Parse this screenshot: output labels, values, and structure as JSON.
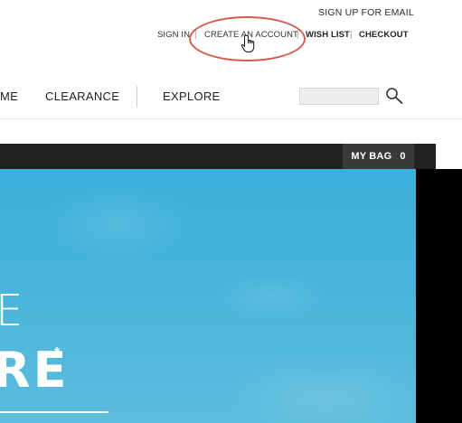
{
  "utility": {
    "email_signup": "SIGN UP FOR EMAIL",
    "sign_in": "SIGN IN",
    "separator": "|",
    "create_account": "CREATE AN ACCOUNT",
    "wish_list": "WISH LIST",
    "checkout": "CHECKOUT"
  },
  "nav": {
    "item_partial": "ME",
    "clearance": "CLEARANCE",
    "explore": "EXPLORE",
    "search_placeholder": ""
  },
  "bag": {
    "label": "MY BAG",
    "count": "0"
  },
  "hero": {
    "line1": "E",
    "line2": "RE",
    "asterisk": "*"
  },
  "colors": {
    "highlight_ring": "#d65a4e",
    "sky": "#47b4db",
    "dark_bar": "#222222"
  },
  "icons": [
    "search-icon",
    "pointer-hand-icon"
  ]
}
